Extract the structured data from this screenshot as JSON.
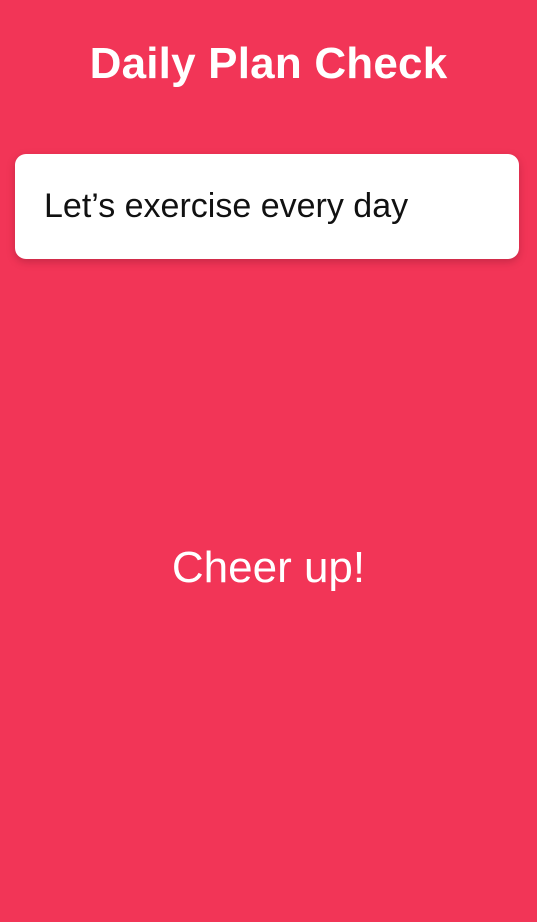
{
  "header": {
    "title": "Daily Plan Check"
  },
  "plan_card": {
    "text": "Let’s exercise every day"
  },
  "message": {
    "text": "Cheer up!"
  },
  "colors": {
    "background": "#f23557",
    "card": "#ffffff",
    "title_text": "#ffffff",
    "card_text": "#111111"
  }
}
